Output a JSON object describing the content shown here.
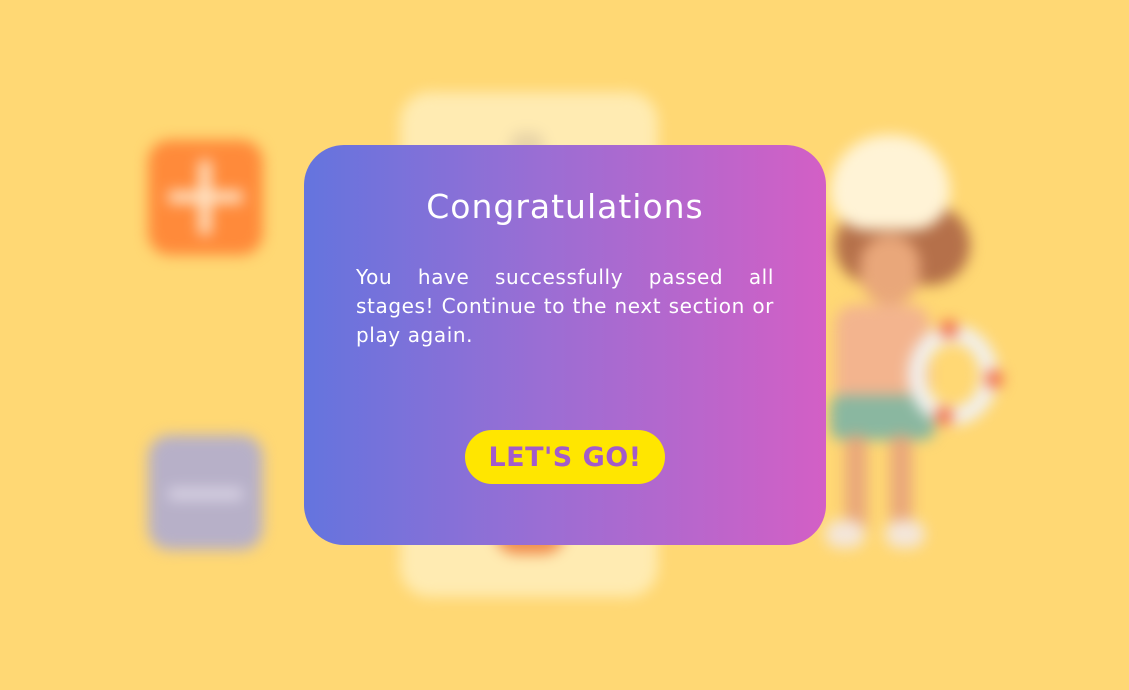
{
  "background": {
    "color": "#FFD874",
    "tiles": [
      {
        "name": "plus-tile",
        "color": "#FF8A3A",
        "icon": "plus-icon"
      },
      {
        "name": "minus-tile",
        "color": "#B7B0C8",
        "icon": "minus-icon"
      }
    ],
    "center_card_color": "#FFEBB2",
    "character": "girl-with-swim-ring"
  },
  "modal": {
    "title": "Congratulations",
    "message": "You have successfully passed all stages! Continue to the next section or play again.",
    "button_label": "LET'S GO!",
    "gradient": [
      "#6474DE",
      "#9A6ED4",
      "#D35FC5"
    ],
    "button_color": "#FFE600",
    "button_text_color": "#A25BCB"
  }
}
